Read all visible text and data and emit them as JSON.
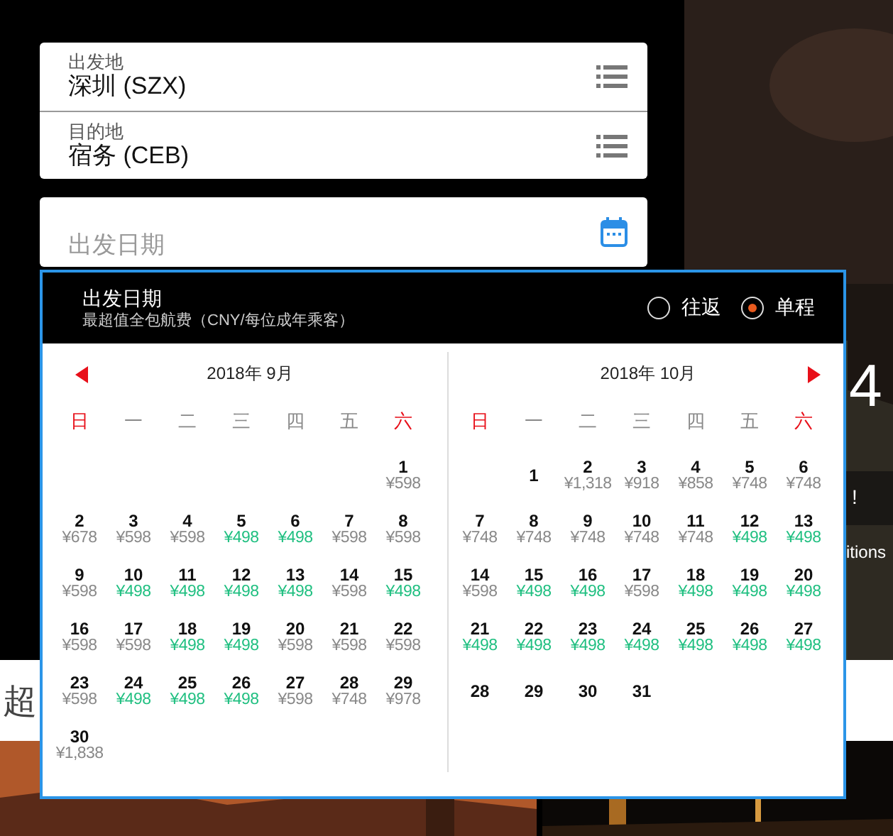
{
  "route_fields": [
    {
      "label": "出发地",
      "value": "深圳 (SZX)"
    },
    {
      "label": "目的地",
      "value": "宿务 (CEB)"
    }
  ],
  "date_field": {
    "placeholder": "出发日期"
  },
  "banner": {
    "big_text": "4",
    "line_1": "!",
    "line_2": "itions",
    "heading": "超"
  },
  "calendar": {
    "title": "出发日期",
    "subtitle": "最超值全包航费（CNY/每位成年乘客）",
    "trip_types": [
      {
        "label": "往返",
        "selected": false
      },
      {
        "label": "单程",
        "selected": true
      }
    ],
    "months": [
      {
        "title": "2018年 9月",
        "weekdays": [
          {
            "label": "日",
            "weekend": true
          },
          {
            "label": "一",
            "weekend": false
          },
          {
            "label": "二",
            "weekend": false
          },
          {
            "label": "三",
            "weekend": false
          },
          {
            "label": "四",
            "weekend": false
          },
          {
            "label": "五",
            "weekend": false
          },
          {
            "label": "六",
            "weekend": true
          }
        ],
        "weeks": [
          [
            {
              "kind": "empty"
            },
            {
              "kind": "empty"
            },
            {
              "kind": "empty"
            },
            {
              "kind": "empty"
            },
            {
              "kind": "empty"
            },
            {
              "kind": "empty"
            },
            {
              "kind": "day",
              "day": "1",
              "price": "¥598",
              "low": false
            }
          ],
          [
            {
              "kind": "day",
              "day": "2",
              "price": "¥678",
              "low": false
            },
            {
              "kind": "day",
              "day": "3",
              "price": "¥598",
              "low": false
            },
            {
              "kind": "day",
              "day": "4",
              "price": "¥598",
              "low": false
            },
            {
              "kind": "day",
              "day": "5",
              "price": "¥498",
              "low": true
            },
            {
              "kind": "day",
              "day": "6",
              "price": "¥498",
              "low": true
            },
            {
              "kind": "day",
              "day": "7",
              "price": "¥598",
              "low": false
            },
            {
              "kind": "day",
              "day": "8",
              "price": "¥598",
              "low": false
            }
          ],
          [
            {
              "kind": "day",
              "day": "9",
              "price": "¥598",
              "low": false
            },
            {
              "kind": "day",
              "day": "10",
              "price": "¥498",
              "low": true
            },
            {
              "kind": "day",
              "day": "11",
              "price": "¥498",
              "low": true
            },
            {
              "kind": "day",
              "day": "12",
              "price": "¥498",
              "low": true
            },
            {
              "kind": "day",
              "day": "13",
              "price": "¥498",
              "low": true
            },
            {
              "kind": "day",
              "day": "14",
              "price": "¥598",
              "low": false
            },
            {
              "kind": "day",
              "day": "15",
              "price": "¥498",
              "low": true
            }
          ],
          [
            {
              "kind": "day",
              "day": "16",
              "price": "¥598",
              "low": false
            },
            {
              "kind": "day",
              "day": "17",
              "price": "¥598",
              "low": false
            },
            {
              "kind": "day",
              "day": "18",
              "price": "¥498",
              "low": true
            },
            {
              "kind": "day",
              "day": "19",
              "price": "¥498",
              "low": true
            },
            {
              "kind": "day",
              "day": "20",
              "price": "¥598",
              "low": false
            },
            {
              "kind": "day",
              "day": "21",
              "price": "¥598",
              "low": false
            },
            {
              "kind": "day",
              "day": "22",
              "price": "¥598",
              "low": false
            }
          ],
          [
            {
              "kind": "day",
              "day": "23",
              "price": "¥598",
              "low": false
            },
            {
              "kind": "day",
              "day": "24",
              "price": "¥498",
              "low": true
            },
            {
              "kind": "day",
              "day": "25",
              "price": "¥498",
              "low": true
            },
            {
              "kind": "day",
              "day": "26",
              "price": "¥498",
              "low": true
            },
            {
              "kind": "day",
              "day": "27",
              "price": "¥598",
              "low": false
            },
            {
              "kind": "day",
              "day": "28",
              "price": "¥748",
              "low": false
            },
            {
              "kind": "day",
              "day": "29",
              "price": "¥978",
              "low": false
            }
          ],
          [
            {
              "kind": "day",
              "day": "30",
              "price": "¥1,838",
              "low": false
            }
          ]
        ]
      },
      {
        "title": "2018年 10月",
        "weekdays": [
          {
            "label": "日",
            "weekend": true
          },
          {
            "label": "一",
            "weekend": false
          },
          {
            "label": "二",
            "weekend": false
          },
          {
            "label": "三",
            "weekend": false
          },
          {
            "label": "四",
            "weekend": false
          },
          {
            "label": "五",
            "weekend": false
          },
          {
            "label": "六",
            "weekend": true
          }
        ],
        "weeks": [
          [
            {
              "kind": "empty"
            },
            {
              "kind": "day",
              "day": "1"
            },
            {
              "kind": "day",
              "day": "2",
              "price": "¥1,318",
              "low": false
            },
            {
              "kind": "day",
              "day": "3",
              "price": "¥918",
              "low": false
            },
            {
              "kind": "day",
              "day": "4",
              "price": "¥858",
              "low": false
            },
            {
              "kind": "day",
              "day": "5",
              "price": "¥748",
              "low": false
            },
            {
              "kind": "day",
              "day": "6",
              "price": "¥748",
              "low": false
            }
          ],
          [
            {
              "kind": "day",
              "day": "7",
              "price": "¥748",
              "low": false
            },
            {
              "kind": "day",
              "day": "8",
              "price": "¥748",
              "low": false
            },
            {
              "kind": "day",
              "day": "9",
              "price": "¥748",
              "low": false
            },
            {
              "kind": "day",
              "day": "10",
              "price": "¥748",
              "low": false
            },
            {
              "kind": "day",
              "day": "11",
              "price": "¥748",
              "low": false
            },
            {
              "kind": "day",
              "day": "12",
              "price": "¥498",
              "low": true
            },
            {
              "kind": "day",
              "day": "13",
              "price": "¥498",
              "low": true
            }
          ],
          [
            {
              "kind": "day",
              "day": "14",
              "price": "¥598",
              "low": false
            },
            {
              "kind": "day",
              "day": "15",
              "price": "¥498",
              "low": true
            },
            {
              "kind": "day",
              "day": "16",
              "price": "¥498",
              "low": true
            },
            {
              "kind": "day",
              "day": "17",
              "price": "¥598",
              "low": false
            },
            {
              "kind": "day",
              "day": "18",
              "price": "¥498",
              "low": true
            },
            {
              "kind": "day",
              "day": "19",
              "price": "¥498",
              "low": true
            },
            {
              "kind": "day",
              "day": "20",
              "price": "¥498",
              "low": true
            }
          ],
          [
            {
              "kind": "day",
              "day": "21",
              "price": "¥498",
              "low": true
            },
            {
              "kind": "day",
              "day": "22",
              "price": "¥498",
              "low": true
            },
            {
              "kind": "day",
              "day": "23",
              "price": "¥498",
              "low": true
            },
            {
              "kind": "day",
              "day": "24",
              "price": "¥498",
              "low": true
            },
            {
              "kind": "day",
              "day": "25",
              "price": "¥498",
              "low": true
            },
            {
              "kind": "day",
              "day": "26",
              "price": "¥498",
              "low": true
            },
            {
              "kind": "day",
              "day": "27",
              "price": "¥498",
              "low": true
            }
          ],
          [
            {
              "kind": "day",
              "day": "28"
            },
            {
              "kind": "day",
              "day": "29"
            },
            {
              "kind": "day",
              "day": "30"
            },
            {
              "kind": "day",
              "day": "31"
            }
          ]
        ]
      }
    ]
  }
}
